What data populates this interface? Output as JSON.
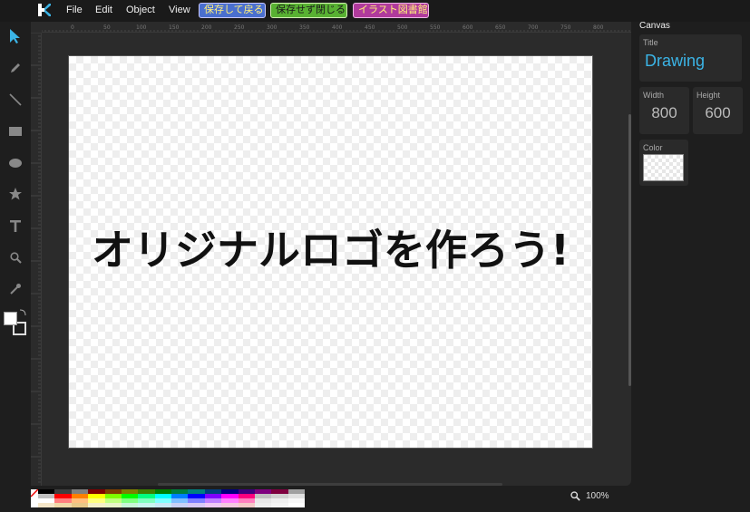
{
  "app": {
    "logo_text": "K",
    "accent_color": "#3bb4e6"
  },
  "menu": {
    "items": [
      "File",
      "Edit",
      "Object",
      "View"
    ],
    "buttons": {
      "save_return": "保存して戻る",
      "close_without_save": "保存せず閉じる",
      "illustration_library": "イラスト図書館"
    }
  },
  "toolbar": {
    "tools": [
      "select-arrow-icon",
      "pencil-icon",
      "line-icon",
      "rectangle-icon",
      "ellipse-icon",
      "star-icon",
      "text-icon",
      "zoom-icon",
      "eyedropper-icon"
    ]
  },
  "ruler": {
    "top_labels": [
      "0",
      "50",
      "100",
      "150",
      "200",
      "250",
      "300",
      "350",
      "400",
      "450",
      "500",
      "550",
      "600",
      "650",
      "700",
      "750",
      "800"
    ]
  },
  "canvas": {
    "text": "オリジナルロゴを作ろう!"
  },
  "colors": {
    "fill": "#ffffff",
    "stroke": "#1e1e1e"
  },
  "zoom": {
    "level": "100%"
  },
  "panel": {
    "heading": "Canvas",
    "title_label": "Title",
    "title_value": "Drawing",
    "width_label": "Width",
    "width_value": "800",
    "height_label": "Height",
    "height_value": "600",
    "color_label": "Color"
  },
  "palette": {
    "rows": [
      [
        "#000000",
        "#3f3f3f",
        "#7f7f7f",
        "#7f0000",
        "#7f3f00",
        "#7f7f00",
        "#3f7f00",
        "#007f00",
        "#007f3f",
        "#007f7f",
        "#003f7f",
        "#00007f",
        "#3f007f",
        "#7f007f",
        "#7f003f",
        "#a0a0a0"
      ],
      [
        "#bfbfbf",
        "#ff0000",
        "#ff7f00",
        "#ffff00",
        "#7fff00",
        "#00ff00",
        "#00ff7f",
        "#00ffff",
        "#007fff",
        "#0000ff",
        "#7f00ff",
        "#ff00ff",
        "#ff007f",
        "#c0c0c0",
        "#d0d0d0",
        "#e0e0e0"
      ],
      [
        "#ffffff",
        "#ff7f7f",
        "#ffbf7f",
        "#ffff7f",
        "#bfff7f",
        "#7fff7f",
        "#7fffbf",
        "#7fffff",
        "#7fbfff",
        "#7f7fff",
        "#bf7fff",
        "#ff7fff",
        "#ff7fbf",
        "#e8e8e8",
        "#f0f0f0",
        "#f8f8f8"
      ],
      [
        "#f5e6c8",
        "#f0d9a8",
        "#e8c888",
        "#f5f0c8",
        "#e8f5c8",
        "#c8f5d8",
        "#c8f5f0",
        "#c8e8f5",
        "#c8d0f5",
        "#d8c8f5",
        "#f0c8f5",
        "#f5c8e0",
        "#f5c8c8",
        "#eeeeee",
        "#f5f5f5",
        "#ffffff"
      ]
    ]
  }
}
